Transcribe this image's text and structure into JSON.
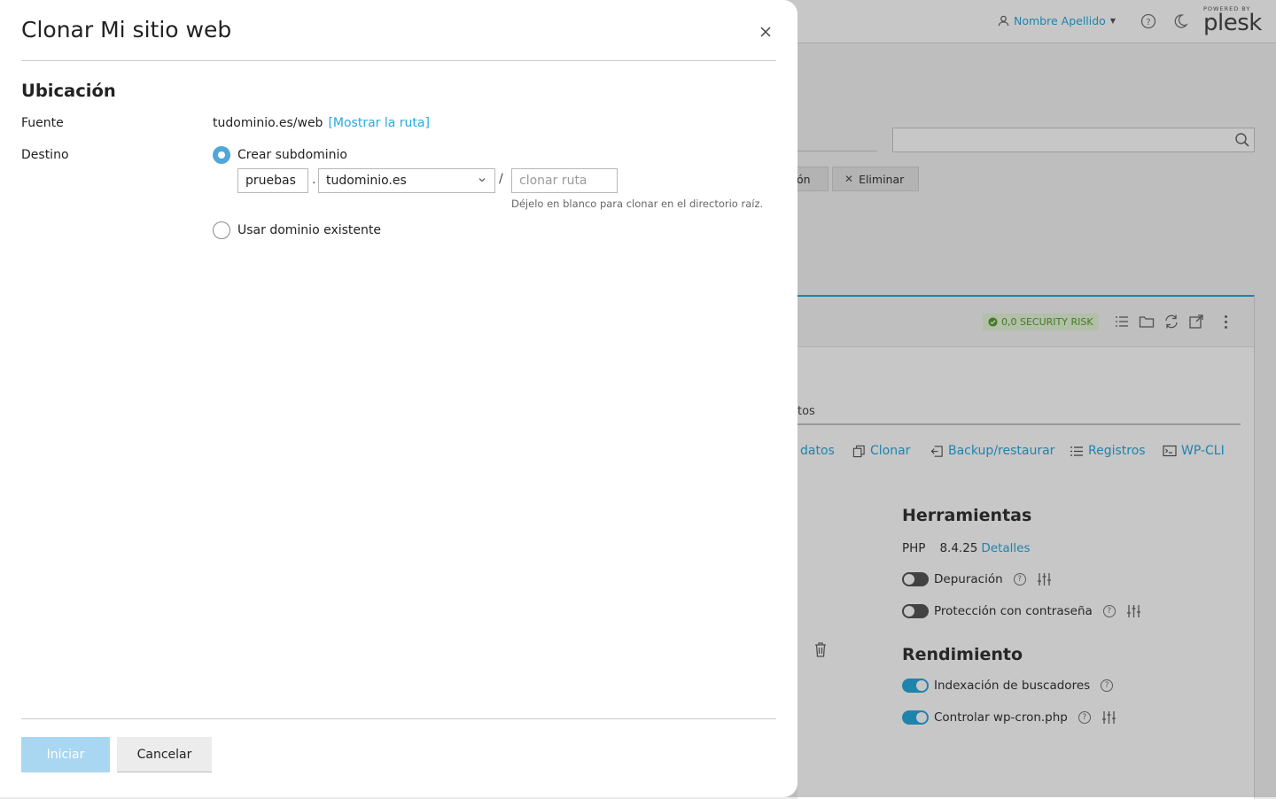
{
  "background": {
    "header": {
      "user_name": "Nombre Apellido",
      "logo_powered": "POWERED BY",
      "logo_name": "plesk"
    },
    "toolbar": {
      "partial_button": "ón",
      "delete_button": "Eliminar"
    },
    "card": {
      "security_badge": "0,0 SECURITY RISK",
      "tab_fragment": "tos",
      "actions": {
        "data_fragment": "datos",
        "clone": "Clonar",
        "backup": "Backup/restaurar",
        "logs": "Registros",
        "wpcli": "WP-CLI"
      },
      "tools_title": "Herramientas",
      "php_label": "PHP",
      "php_version": "8.4.25",
      "php_details": "Detalles",
      "debug_label": "Depuración",
      "password_label": "Protección con contraseña",
      "performance_title": "Rendimiento",
      "indexing_label": "Indexación de buscadores",
      "cron_label": "Controlar wp-cron.php",
      "toggles": {
        "debug": false,
        "password": false,
        "indexing": true,
        "cron": true
      }
    }
  },
  "modal": {
    "title": "Clonar Mi sitio web",
    "section_title": "Ubicación",
    "source_label": "Fuente",
    "source_value": "tudominio.es/web",
    "source_link": "[Mostrar la ruta]",
    "destination_label": "Destino",
    "options": {
      "create_subdomain": {
        "label": "Crear subdominio",
        "checked": true
      },
      "existing_domain": {
        "label": "Usar dominio existente",
        "checked": false
      }
    },
    "subdomain_value": "pruebas",
    "dot": ".",
    "domain_selected": "tudominio.es",
    "slash": "/",
    "path_placeholder": "clonar ruta",
    "path_hint": "Déjelo en blanco para clonar en el directorio raíz.",
    "buttons": {
      "start": "Iniciar",
      "cancel": "Cancelar"
    }
  },
  "colors": {
    "accent": "#28aade",
    "radio": "#4fa7dc",
    "primary_disabled": "#a9d7f2",
    "badge_green": "#5a9d2d"
  }
}
